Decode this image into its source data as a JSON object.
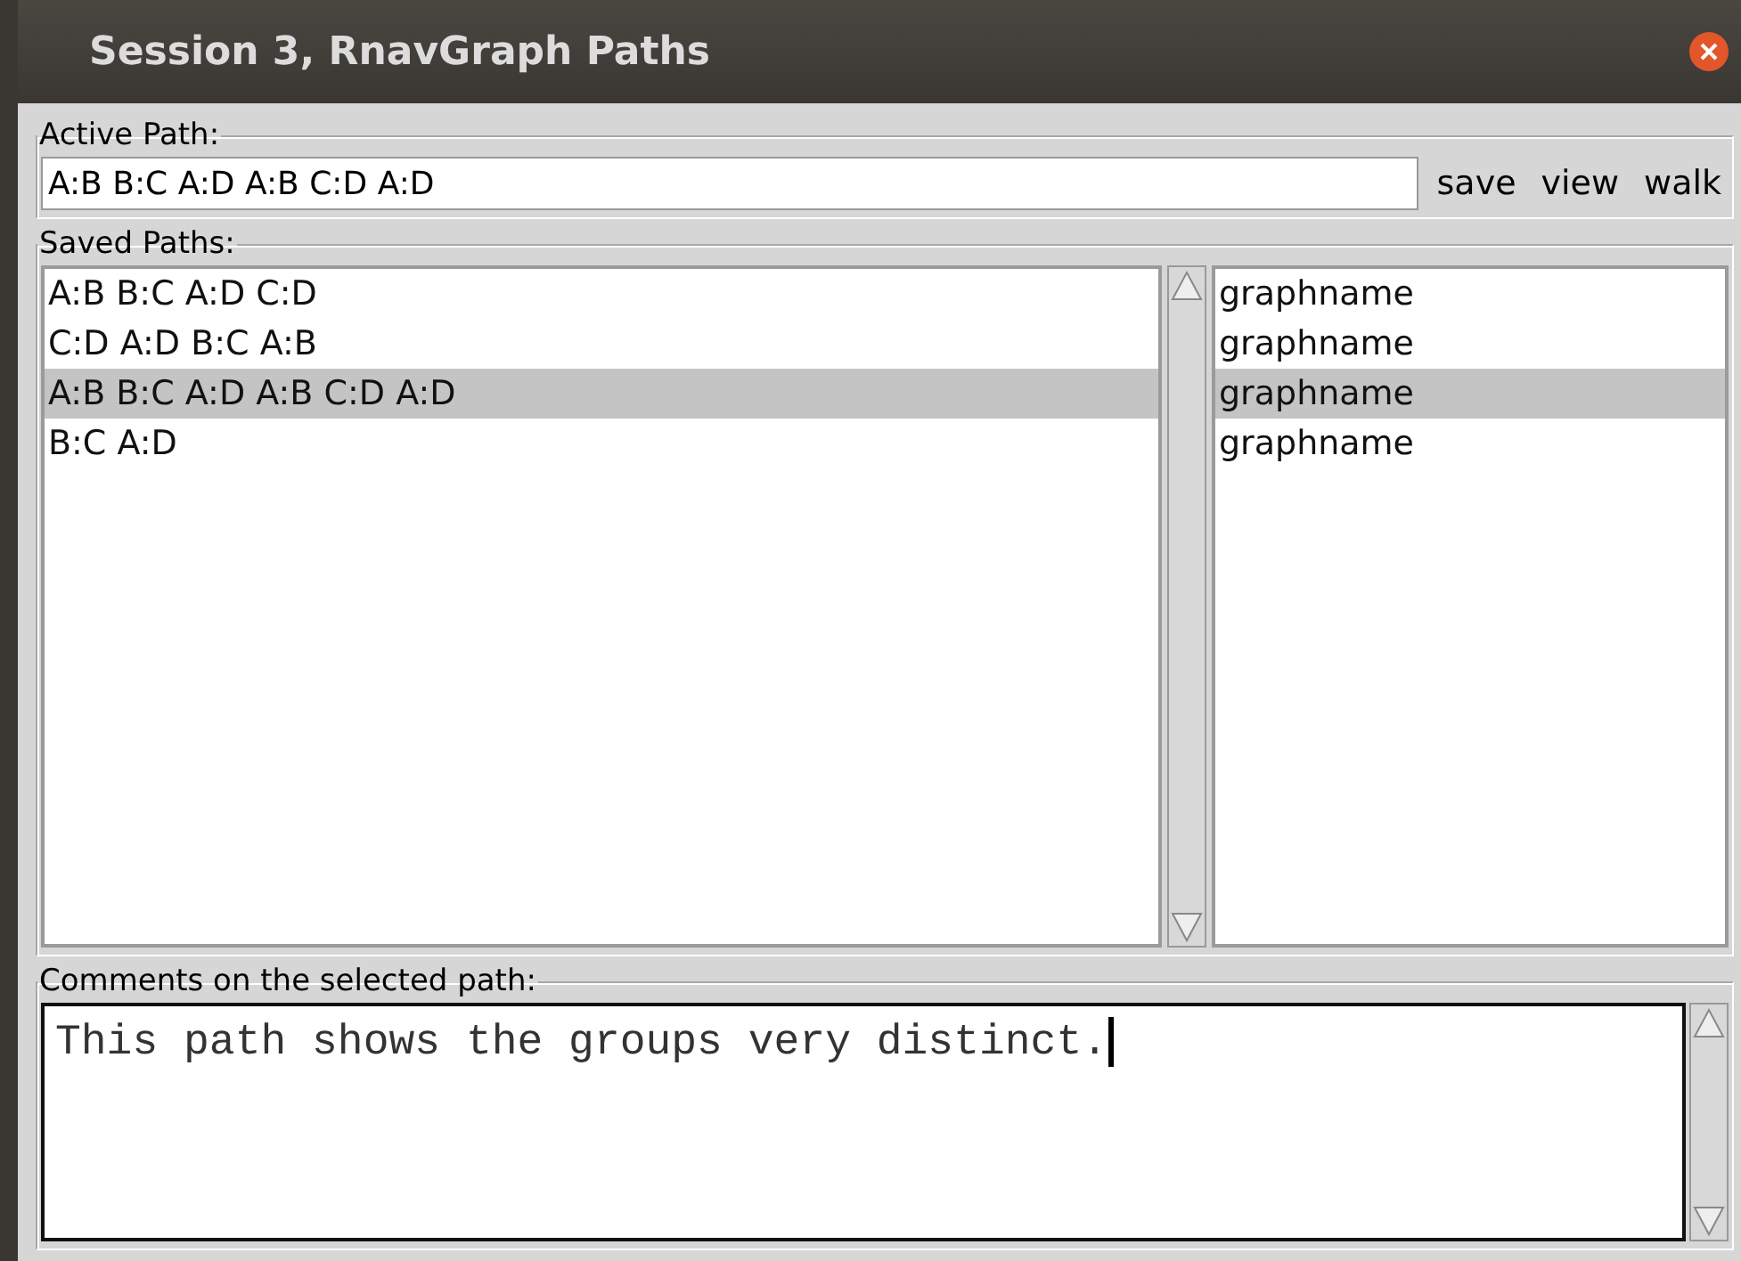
{
  "window": {
    "title": "Session 3, RnavGraph Paths"
  },
  "active_path": {
    "label": "Active Path:",
    "value": "A:B B:C A:D A:B C:D A:D",
    "buttons": [
      "save",
      "view",
      "walk"
    ]
  },
  "saved_paths": {
    "label": "Saved Paths:",
    "rows": [
      {
        "path": "A:B B:C A:D C:D",
        "graph": "graphname",
        "selected": false
      },
      {
        "path": "C:D A:D B:C A:B",
        "graph": "graphname",
        "selected": false
      },
      {
        "path": "A:B B:C A:D A:B C:D A:D",
        "graph": "graphname",
        "selected": true
      },
      {
        "path": "B:C A:D",
        "graph": "graphname",
        "selected": false
      }
    ]
  },
  "comments": {
    "label": "Comments on the selected path:",
    "value": "This path shows the groups very distinct."
  }
}
